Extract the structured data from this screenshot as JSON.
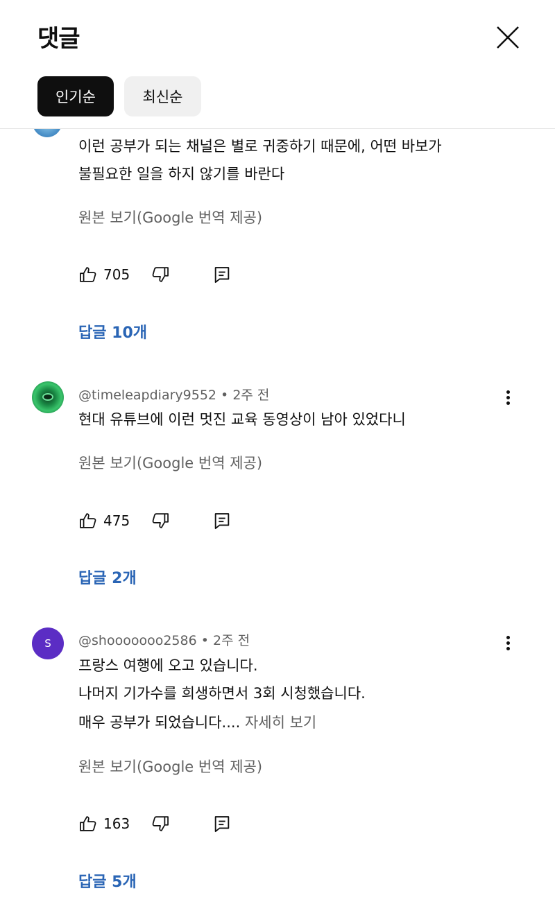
{
  "header": {
    "title": "댓글",
    "close_icon": "close-icon"
  },
  "sort_chips": [
    {
      "label": "인기순",
      "active": true
    },
    {
      "label": "최신순",
      "active": false
    }
  ],
  "comments": [
    {
      "author": "",
      "time": "",
      "lines": [
        "이런 공부가 되는 채널은 별로 귀중하기 때문에, 어떤 바보가",
        "불필요한 일을 하지 않기를 바란다"
      ],
      "translate": "원본 보기(Google 번역 제공)",
      "likes": "705",
      "replies": "답글 10개"
    },
    {
      "author": "@timeleapdiary9552",
      "sep": "•",
      "time": "2주 전",
      "lines": [
        "현대 유튜브에 이런 멋진 교육 동영상이 남아 있었다니"
      ],
      "translate": "원본 보기(Google 번역 제공)",
      "likes": "475",
      "replies": "답글 2개"
    },
    {
      "author": "@shooooooo2586",
      "sep": "•",
      "time": "2주 전",
      "avatar_letter": "S",
      "lines": [
        "프랑스 여행에 오고 있습니다.",
        "나머지 기가수를 희생하면서 3회 시청했습니다.",
        "매우 공부가 되었습니다...."
      ],
      "read_more": "자세히 보기",
      "translate": "원본 보기(Google 번역 제공)",
      "likes": "163",
      "replies": "답글 5개"
    }
  ],
  "colors": {
    "reply_link": "#2a65b5",
    "secondary_text": "#606060",
    "active_chip": "#0f0f0f",
    "idle_chip": "#f0f0f0"
  },
  "icons": [
    "close-icon",
    "thumbs-up-icon",
    "thumbs-down-icon",
    "reply-icon",
    "more-vert-icon"
  ]
}
